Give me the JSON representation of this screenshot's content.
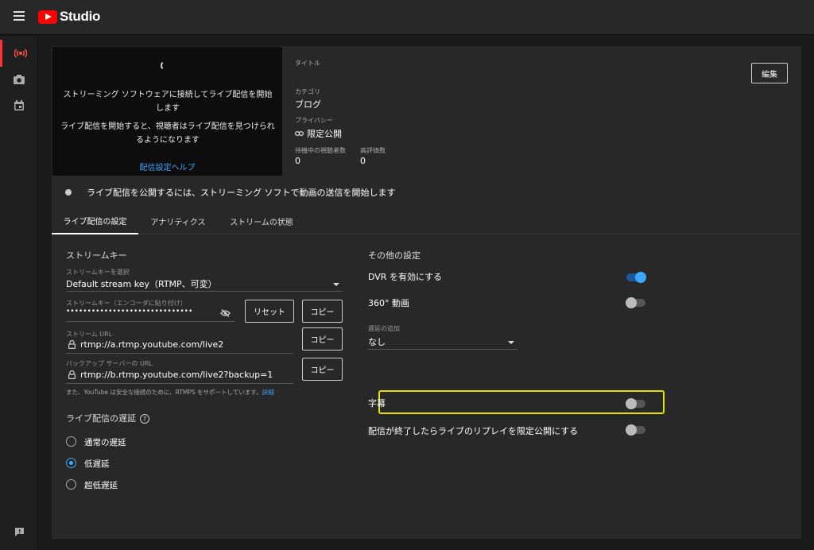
{
  "app": {
    "name": "Studio"
  },
  "preview": {
    "message1": "ストリーミング ソフトウェアに接続してライブ配信を開始します",
    "message2": "ライブ配信を開始すると、視聴者はライブ配信を見つけられるようになります",
    "help_link": "配信設定ヘルプ"
  },
  "info": {
    "title_label": "タイトル",
    "category_label": "カテゴリ",
    "category_value": "ブログ",
    "privacy_label": "プライバシー",
    "privacy_value": "限定公開",
    "viewers_label": "待機中の視聴者数",
    "viewers_value": "0",
    "likes_label": "高評価数",
    "likes_value": "0",
    "edit_button": "編集"
  },
  "status_message": "ライブ配信を公開するには、ストリーミング ソフトで動画の送信を開始します",
  "tabs": [
    {
      "label": "ライブ配信の設定",
      "active": true
    },
    {
      "label": "アナリティクス",
      "active": false
    },
    {
      "label": "ストリームの状態",
      "active": false
    }
  ],
  "stream_key": {
    "section_title": "ストリームキー",
    "select_label": "ストリームキーを選択",
    "select_value": "Default stream key（RTMP、可変）",
    "key_label": "ストリームキー（エンコーダに貼り付け）",
    "key_value": "••••••••••••••••••••••••••••••",
    "reset_button": "リセット",
    "copy_button": "コピー",
    "url_label": "ストリーム URL",
    "url_value": "rtmp://a.rtmp.youtube.com/live2",
    "backup_label": "バックアップ サーバーの URL",
    "backup_value": "rtmp://b.rtmp.youtube.com/live2?backup=1",
    "note": "また、YouTube は安全な接続のために、RTMPS をサポートしています。",
    "note_link": "詳細"
  },
  "latency": {
    "title": "ライブ配信の遅延",
    "help": "?",
    "options": [
      {
        "label": "通常の遅延",
        "checked": false
      },
      {
        "label": "低遅延",
        "checked": true
      },
      {
        "label": "超低遅延",
        "checked": false
      }
    ]
  },
  "other": {
    "title": "その他の設定",
    "dvr": {
      "label": "DVR を有効にする",
      "on": true
    },
    "video360": {
      "label": "360° 動画",
      "on": false
    },
    "delay_label": "遅延の追加",
    "delay_value": "なし",
    "captions": {
      "label": "字幕",
      "on": false
    },
    "replay": {
      "label": "配信が終了したらライブのリプレイを限定公開にする",
      "on": false
    }
  },
  "colors": {
    "accent": "#3ea6ff",
    "brand": "#ff0000",
    "highlight": "#e6e000"
  }
}
